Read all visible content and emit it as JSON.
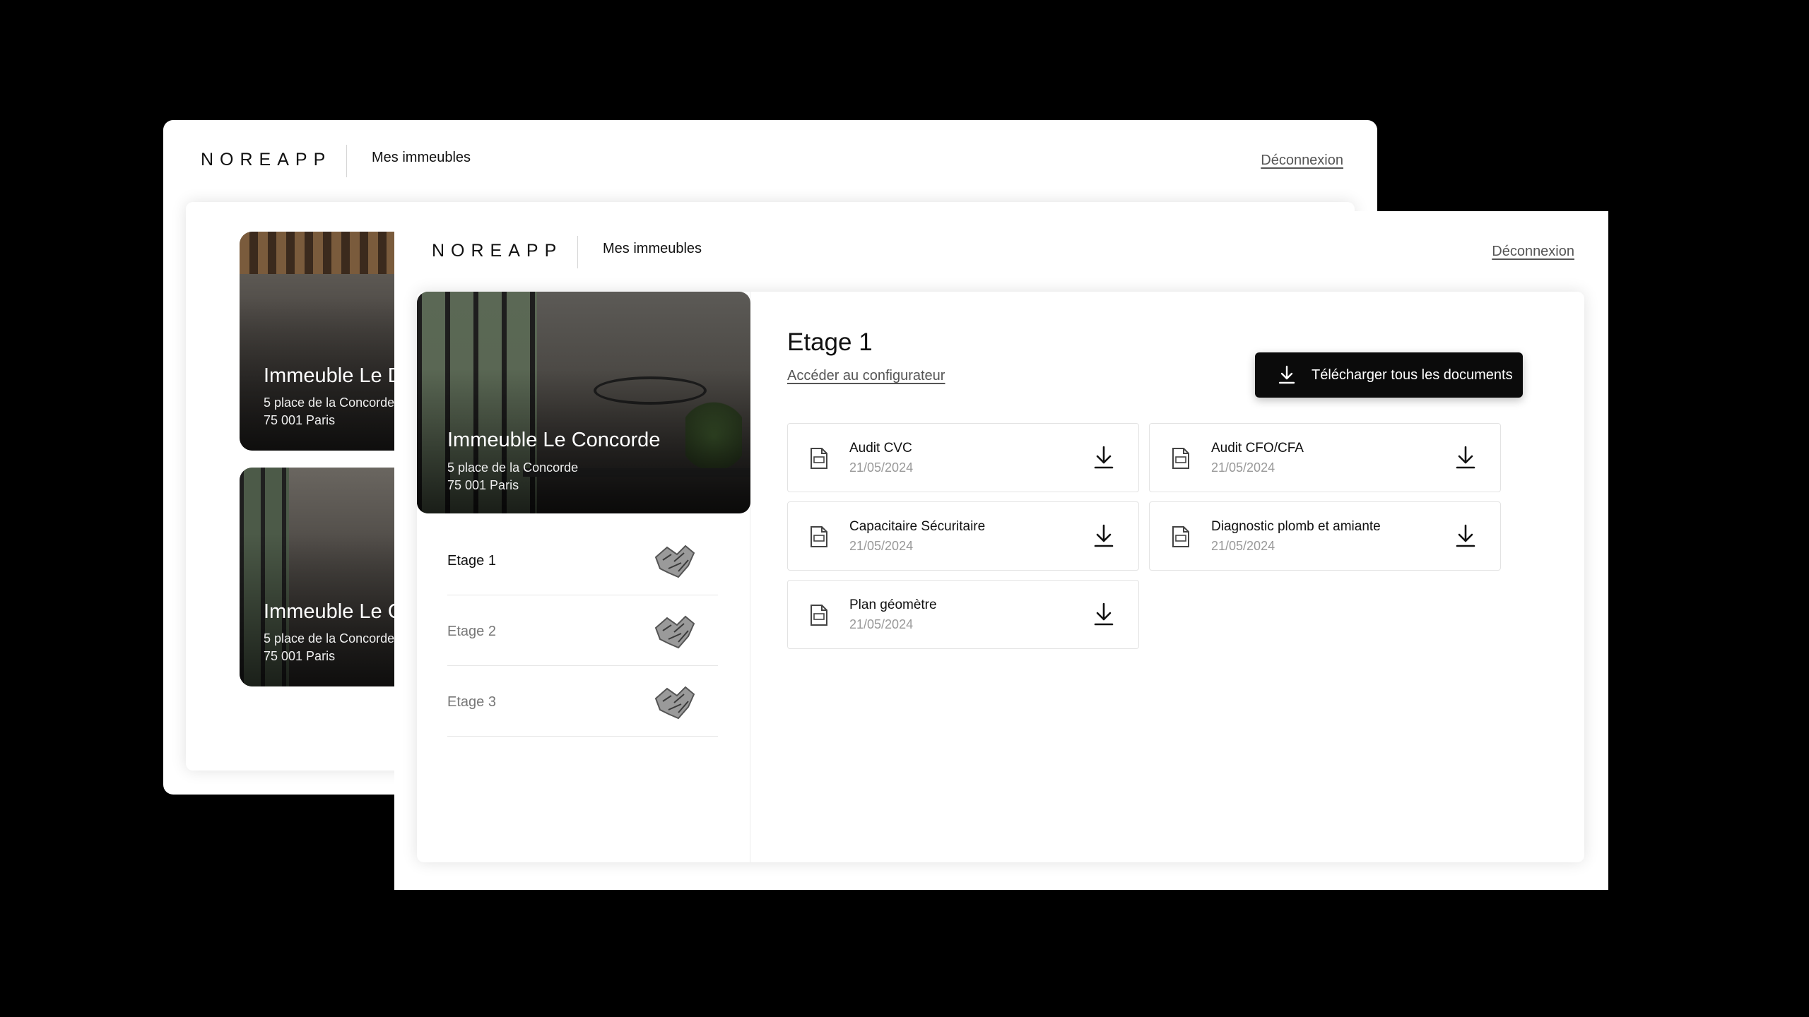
{
  "brand": "NOREAPP",
  "nav": {
    "my_buildings": "Mes immeubles",
    "logout": "Déconnexion"
  },
  "back_window": {
    "buildings": [
      {
        "name": "Immeuble Le Daup",
        "address_line1": "5 place de la Concorde",
        "address_line2": "75 001 Paris"
      },
      {
        "name": "Immeuble Le Conc",
        "address_line1": "5 place de la Concorde",
        "address_line2": "75 001 Paris"
      }
    ]
  },
  "building": {
    "name": "Immeuble Le Concorde",
    "address_line1": "5 place de la Concorde",
    "address_line2": "75 001 Paris"
  },
  "floors": [
    {
      "label": "Etage 1",
      "active": true
    },
    {
      "label": "Etage 2",
      "active": false
    },
    {
      "label": "Etage 3",
      "active": false
    }
  ],
  "detail": {
    "title": "Etage 1",
    "configurator_link": "Accéder au configurateur",
    "download_all": "Télécharger tous les documents"
  },
  "documents": [
    {
      "name": "Audit CVC",
      "date": "21/05/2024"
    },
    {
      "name": "Audit CFO/CFA",
      "date": "21/05/2024"
    },
    {
      "name": "Capacitaire Sécuritaire",
      "date": "21/05/2024"
    },
    {
      "name": "Diagnostic plomb et amiante",
      "date": "21/05/2024"
    },
    {
      "name": "Plan géomètre",
      "date": "21/05/2024"
    }
  ],
  "icons": {
    "download": "download-icon",
    "pdf": "pdf-file-icon",
    "floor_plan": "floor-plan-thumbnail"
  },
  "colors": {
    "primary_button": "#0b0b0b",
    "background": "#000000",
    "muted_text": "#999999"
  }
}
